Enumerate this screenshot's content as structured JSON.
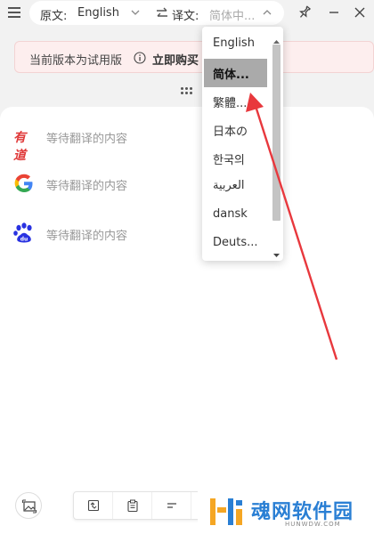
{
  "header": {
    "source_label": "原文:",
    "source_lang": "English",
    "target_label": "译文:",
    "target_lang": "简体中..."
  },
  "trial": {
    "message": "当前版本为试用版",
    "buy_label": "立即购买"
  },
  "engines": [
    {
      "name": "youdao",
      "logo_text": "有道",
      "placeholder": "等待翻译的内容"
    },
    {
      "name": "google",
      "placeholder": "等待翻译的内容"
    },
    {
      "name": "baidu",
      "placeholder": "等待翻译的内容"
    }
  ],
  "language_dropdown": {
    "options": [
      "English",
      "简体...",
      "繁體...",
      "日本の",
      "한국의",
      "العربية",
      "dansk",
      "Deuts..."
    ],
    "selected": "简体..."
  },
  "watermark": {
    "title": "魂网软件园",
    "subtitle": "HUNWDW.COM"
  },
  "colors": {
    "accent_arrow": "#e8383d",
    "trial_bg": "#fdeeee",
    "watermark_blue": "#2a7fd4",
    "watermark_orange": "#f5a623"
  }
}
